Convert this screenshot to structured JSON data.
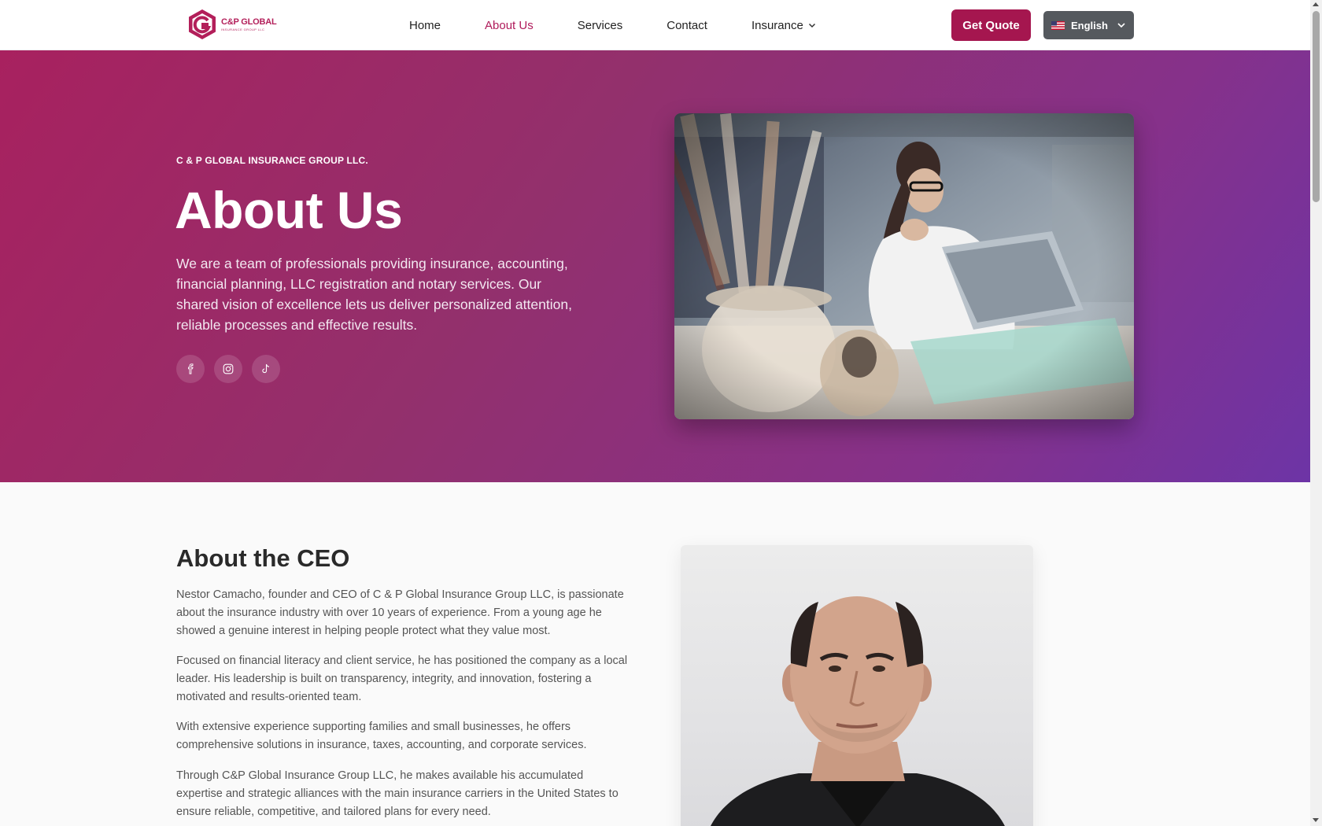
{
  "header": {
    "logo_name": "C&P GLOBAL",
    "logo_sub": "INSURANCE GROUP LLC",
    "nav": [
      {
        "label": "Home",
        "active": false
      },
      {
        "label": "About Us",
        "active": true
      },
      {
        "label": "Services",
        "active": false
      },
      {
        "label": "Contact",
        "active": false
      },
      {
        "label": "Insurance",
        "active": false,
        "dropdown": true
      }
    ],
    "cta_label": "Get Quote",
    "language": "English",
    "language_flag_icon": "us-flag-icon"
  },
  "hero": {
    "eyebrow": "C & P GLOBAL INSURANCE GROUP LLC.",
    "title": "About Us",
    "description": "We are a team of professionals providing insurance, accounting, financial planning, LLC registration and notary services. Our shared vision of excellence lets us deliver personalized attention, reliable processes and effective results.",
    "socials": [
      "facebook-icon",
      "instagram-icon",
      "tiktok-icon"
    ]
  },
  "ceo": {
    "title": "About the CEO",
    "paragraphs": [
      "Nestor Camacho, founder and CEO of C & P Global Insurance Group LLC, is passionate about the insurance industry with over 10 years of experience. From a young age he showed a genuine interest in helping people protect what they value most.",
      "Focused on financial literacy and client service, he has positioned the company as a local leader. His leadership is built on transparency, integrity, and innovation, fostering a motivated and results-oriented team.",
      "With extensive experience supporting families and small businesses, he offers comprehensive solutions in insurance, taxes, accounting, and corporate services.",
      "Through C&P Global Insurance Group LLC, he makes available his accumulated expertise and strategic alliances with the main insurance carriers in the United States to ensure reliable, competitive, and tailored plans for every need."
    ]
  },
  "colors": {
    "brand": "#a5164f",
    "hero_start": "#a8215f",
    "hero_end": "#6d34a6"
  }
}
